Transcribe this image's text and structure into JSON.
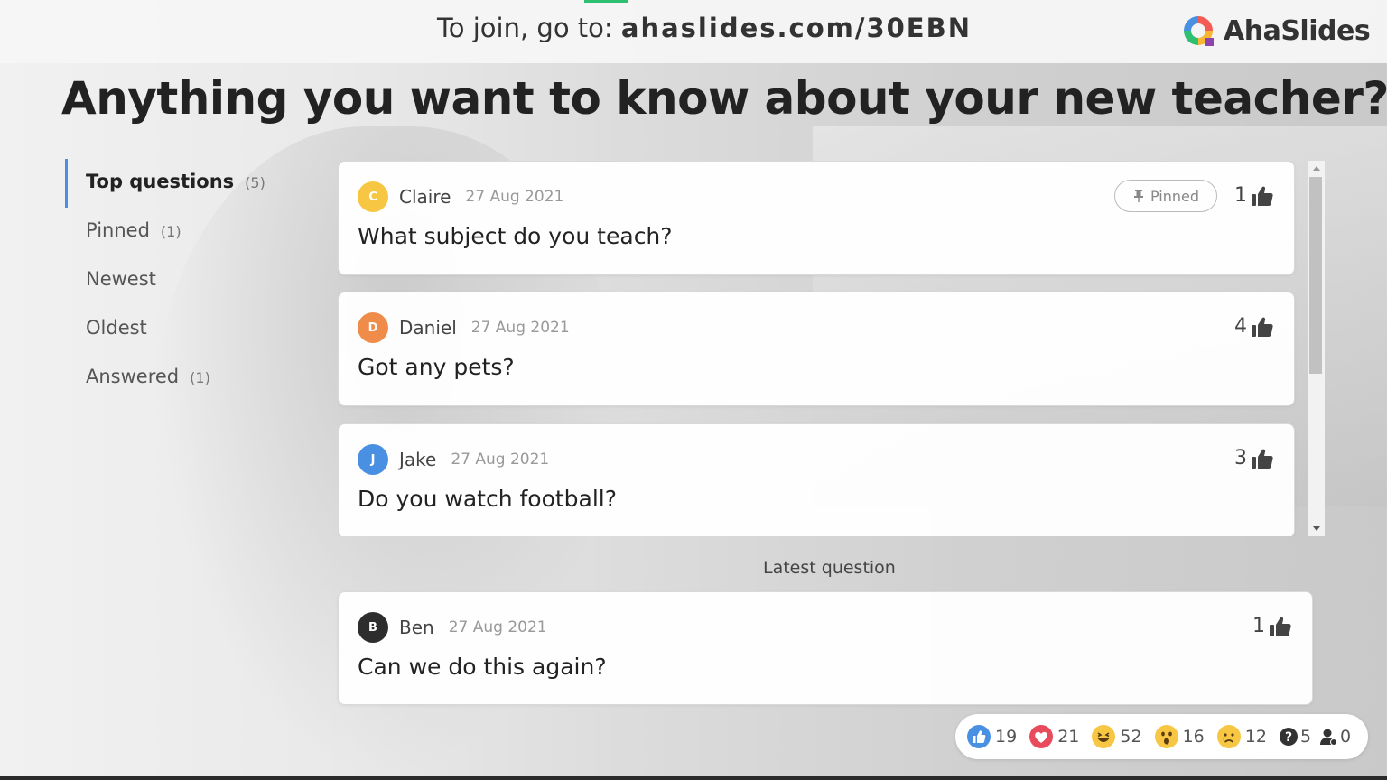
{
  "header": {
    "join_prefix": "To join, go to: ",
    "join_url": "ahaslides.com/30EBN",
    "logo_text": "AhaSlides",
    "accent_color": "#2fbf71"
  },
  "title": "Anything you want to know about your new teacher?",
  "sidebar": {
    "items": [
      {
        "label": "Top questions",
        "count": "(5)"
      },
      {
        "label": "Pinned",
        "count": "(1)"
      },
      {
        "label": "Newest",
        "count": ""
      },
      {
        "label": "Oldest",
        "count": ""
      },
      {
        "label": "Answered",
        "count": "(1)"
      }
    ]
  },
  "questions": [
    {
      "initial": "C",
      "author": "Claire",
      "date": "27 Aug 2021",
      "text": "What subject do you teach?",
      "votes": "1",
      "pinned_label": "Pinned",
      "avatar_color": "#f7c744"
    },
    {
      "initial": "D",
      "author": "Daniel",
      "date": "27 Aug 2021",
      "text": "Got any pets?",
      "votes": "4",
      "avatar_color": "#f08c4a"
    },
    {
      "initial": "J",
      "author": "Jake",
      "date": "27 Aug 2021",
      "text": "Do you watch football?",
      "votes": "3",
      "avatar_color": "#4a90e2"
    }
  ],
  "latest": {
    "label": "Latest question",
    "initial": "B",
    "author": "Ben",
    "date": "27 Aug 2021",
    "text": "Can we do this again?",
    "votes": "1",
    "avatar_color": "#2d2d2d"
  },
  "reactions": [
    {
      "icon": "like-icon",
      "count": "19"
    },
    {
      "icon": "heart-icon",
      "count": "21"
    },
    {
      "icon": "laugh-icon",
      "count": "52"
    },
    {
      "icon": "wow-icon",
      "count": "16"
    },
    {
      "icon": "sad-icon",
      "count": "12"
    },
    {
      "icon": "question-icon",
      "count": "5"
    },
    {
      "icon": "audience-icon",
      "count": "0"
    }
  ]
}
